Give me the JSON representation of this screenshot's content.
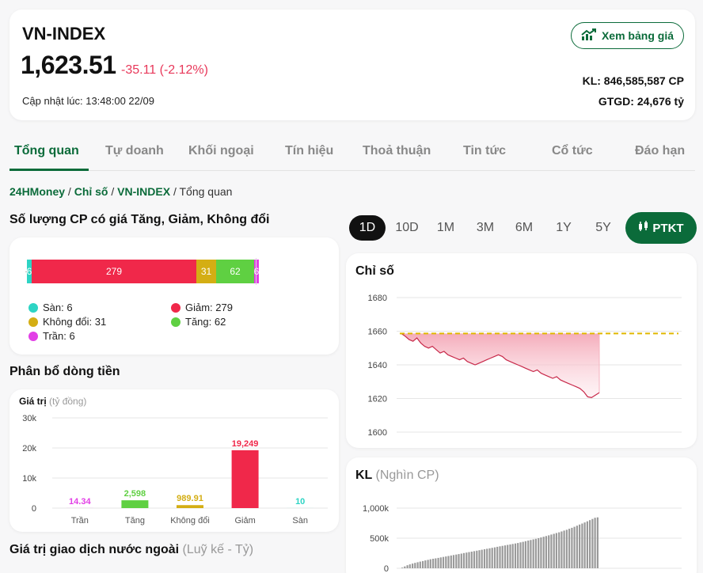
{
  "header": {
    "index_name": "VN-INDEX",
    "value": "1,623.51",
    "change": "-35.11 (-2.12%)",
    "updated": "Cập nhật lúc: 13:48:00 22/09",
    "price_board_button": "Xem bảng giá",
    "volume": "KL: 846,585,587 CP",
    "turnover": "GTGD: 24,676 tỷ"
  },
  "tabs": [
    "Tổng quan",
    "Tự doanh",
    "Khối ngoại",
    "Tín hiệu",
    "Thoả thuận",
    "Tin tức",
    "Cổ tức",
    "Đáo hạn"
  ],
  "breadcrumb": {
    "home": "24HMoney",
    "sep": " / ",
    "level2": "Chỉ số",
    "level3": "VN-INDEX",
    "current": "Tổng quan"
  },
  "breadth": {
    "title": "Số lượng CP có giá Tăng, Giảm, Không đổi",
    "segments": [
      {
        "key": "san",
        "value": 6,
        "color": "#2dd4c4"
      },
      {
        "key": "giam",
        "value": 279,
        "color": "#f0284a"
      },
      {
        "key": "khongdoi",
        "value": 31,
        "color": "#d4ae14"
      },
      {
        "key": "tang",
        "value": 62,
        "color": "#5fd042"
      },
      {
        "key": "tran",
        "value": 6,
        "color": "#e23fe6"
      }
    ],
    "legend": {
      "san": "Sàn: 6",
      "giam": "Giảm: 279",
      "khongdoi": "Không đổi: 31",
      "tang": "Tăng: 62",
      "tran": "Trần: 6"
    }
  },
  "flow": {
    "title": "Phân bổ dòng tiền",
    "unit_label": "Giá trị",
    "unit": "(tỷ đồng)"
  },
  "foreign": {
    "title": "Giá trị giao dịch nước ngoài",
    "note": "(Luỹ kế - Tỷ)"
  },
  "periods": [
    "1D",
    "10D",
    "1M",
    "3M",
    "6M",
    "1Y",
    "5Y"
  ],
  "ptkt_button": "PTKT",
  "index_chart_title": "Chỉ số",
  "volume_chart": {
    "title": "KL",
    "unit": "(Nghìn CP)"
  },
  "chart_data": [
    {
      "type": "bar",
      "categories": [
        "Trần",
        "Tăng",
        "Không đổi",
        "Giảm",
        "Sàn"
      ],
      "values": [
        14.34,
        2598,
        989.91,
        19249,
        10
      ],
      "data_labels": [
        "14.34",
        "2,598",
        "989.91",
        "19,249",
        "10"
      ],
      "colors": [
        "#e23fe6",
        "#5fd042",
        "#d4ae14",
        "#f0284a",
        "#2dd4c4"
      ],
      "yticks": [
        "30k",
        "20k",
        "10k",
        "0"
      ],
      "ylim": [
        0,
        30000
      ]
    },
    {
      "type": "area",
      "yticks": [
        1680,
        1660,
        1640,
        1620,
        1600
      ],
      "ylim": [
        1600,
        1680
      ],
      "reference": 1658.62,
      "values": [
        1658.6,
        1657,
        1655,
        1654,
        1656,
        1653,
        1651,
        1650,
        1651,
        1649,
        1647,
        1648,
        1646,
        1645,
        1644,
        1643,
        1644,
        1642,
        1641,
        1640,
        1641,
        1642,
        1643,
        1644,
        1645,
        1646,
        1645,
        1643,
        1642,
        1641,
        1640,
        1639,
        1638,
        1637,
        1636,
        1637,
        1635,
        1634,
        1633,
        1632,
        1633,
        1631,
        1630,
        1629,
        1628,
        1627,
        1626,
        1624,
        1621,
        1620.5,
        1622,
        1623.5
      ]
    },
    {
      "type": "bar",
      "yticks": [
        "1,000k",
        "500k",
        "0"
      ],
      "ylim": [
        0,
        1000000
      ],
      "values_k": [
        10,
        30,
        50,
        65,
        78,
        90,
        100,
        110,
        120,
        130,
        140,
        150,
        158,
        165,
        172,
        180,
        188,
        196,
        204,
        212,
        220,
        228,
        236,
        244,
        252,
        260,
        268,
        276,
        284,
        292,
        300,
        308,
        316,
        324,
        332,
        340,
        348,
        356,
        364,
        372,
        380,
        388,
        396,
        404,
        412,
        420,
        430,
        440,
        450,
        460,
        470,
        480,
        490,
        500,
        512,
        524,
        536,
        548,
        560,
        572,
        585,
        598,
        612,
        626,
        640,
        656,
        672,
        690,
        708,
        726,
        744,
        762,
        780,
        800,
        820,
        840,
        846
      ]
    }
  ],
  "colors": {
    "brand": "#0b6b3a",
    "down": "#e8385a",
    "reference": "#e0b800"
  }
}
